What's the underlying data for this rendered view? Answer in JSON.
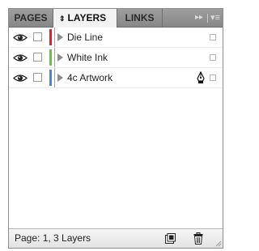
{
  "tabs": {
    "pages": "PAGES",
    "layers_arrows": "⇕",
    "layers": "LAYERS",
    "links": "LINKS",
    "expand": "▸▸",
    "menu": "▾≡"
  },
  "layers": [
    {
      "name": "Die Line",
      "color": "#e0202a",
      "visible": true,
      "locked": false,
      "has_pen": false
    },
    {
      "name": "White Ink",
      "color": "#6cc04a",
      "visible": true,
      "locked": false,
      "has_pen": false
    },
    {
      "name": "4c Artwork",
      "color": "#4f7fd6",
      "visible": true,
      "locked": false,
      "has_pen": true
    }
  ],
  "footer": {
    "status": "Page: 1, 3 Layers",
    "new_layer_icon": "new-layer-icon",
    "delete_icon": "trash-icon"
  }
}
